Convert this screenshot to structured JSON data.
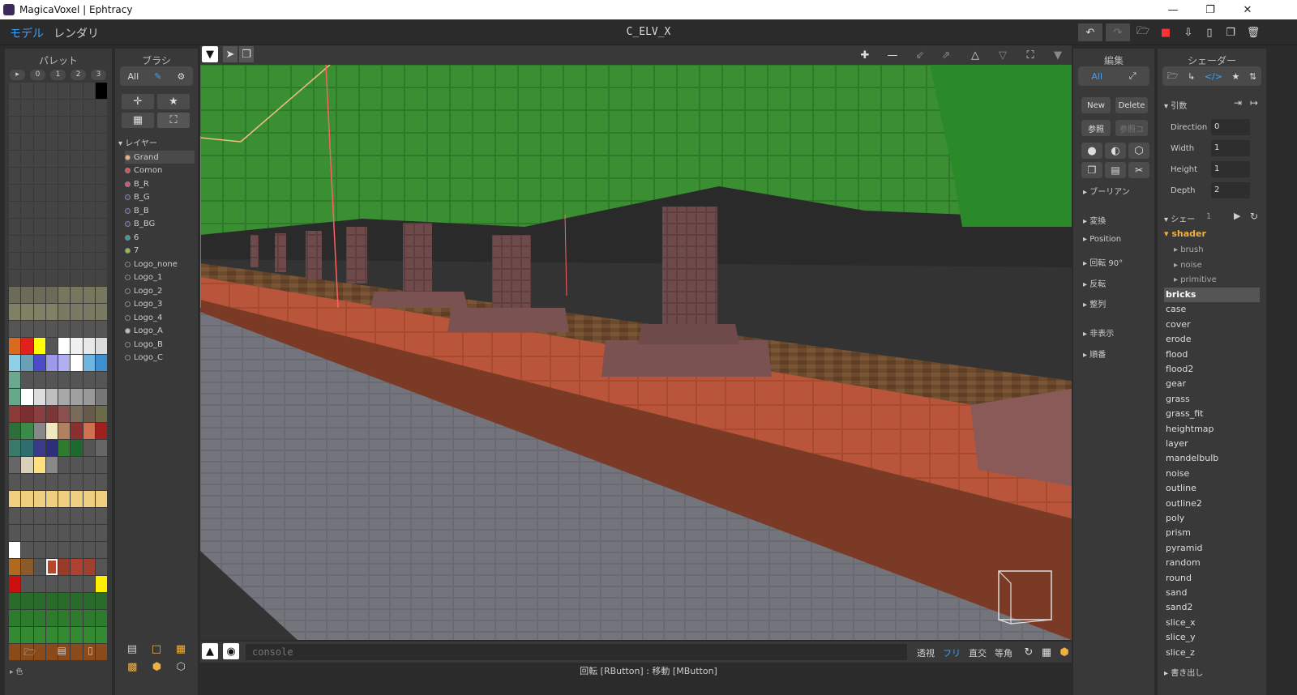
{
  "window": {
    "title": "MagicaVoxel | Ephtracy"
  },
  "menu": {
    "tab_model": "モデル",
    "tab_render": "レンダリ",
    "document": "C_ELV_X"
  },
  "palette": {
    "title": "パレット",
    "tabs": [
      "▸",
      "0",
      "1",
      "2",
      "3"
    ],
    "footer_label": "▸ 色",
    "rows": [
      [
        "#444",
        "#444",
        "#444",
        "#444",
        "#444",
        "#444",
        "#444",
        "#000"
      ],
      [
        "#444",
        "#444",
        "#444",
        "#444",
        "#444",
        "#444",
        "#444",
        "#444"
      ],
      [
        "#444",
        "#444",
        "#444",
        "#444",
        "#444",
        "#444",
        "#444",
        "#444"
      ],
      [
        "#444",
        "#444",
        "#444",
        "#444",
        "#444",
        "#444",
        "#444",
        "#444"
      ],
      [
        "#444",
        "#444",
        "#444",
        "#444",
        "#444",
        "#444",
        "#444",
        "#444"
      ],
      [
        "#444",
        "#444",
        "#444",
        "#444",
        "#444",
        "#444",
        "#444",
        "#444"
      ],
      [
        "#444",
        "#444",
        "#444",
        "#444",
        "#444",
        "#444",
        "#444",
        "#444"
      ],
      [
        "#444",
        "#444",
        "#444",
        "#444",
        "#444",
        "#444",
        "#444",
        "#444"
      ],
      [
        "#444",
        "#444",
        "#444",
        "#444",
        "#444",
        "#444",
        "#444",
        "#444"
      ],
      [
        "#444",
        "#444",
        "#444",
        "#444",
        "#444",
        "#444",
        "#444",
        "#444"
      ],
      [
        "#444",
        "#444",
        "#444",
        "#444",
        "#444",
        "#444",
        "#444",
        "#444"
      ],
      [
        "#444",
        "#444",
        "#444",
        "#444",
        "#444",
        "#444",
        "#444",
        "#444"
      ],
      [
        "#6b6b5a",
        "#6b6b5a",
        "#6b6b5a",
        "#6b6b5a",
        "#77775e",
        "#77775e",
        "#77775e",
        "#77775e"
      ],
      [
        "#808066",
        "#808066",
        "#808066",
        "#808066",
        "#7a7a62",
        "#7a7a62",
        "#7a7a62",
        "#7a7a62"
      ],
      [
        "#555",
        "#555",
        "#555",
        "#555",
        "#555",
        "#555",
        "#555",
        "#555"
      ],
      [
        "#d96a1f",
        "#e0201a",
        "#ffff00",
        "#555",
        "#ffffff",
        "#f0f0f0",
        "#e8e8e8",
        "#dcdcdc"
      ],
      [
        "#8fcfe8",
        "#6b9fb5",
        "#4b4bc8",
        "#9b9be8",
        "#b0b0f0",
        "#ffffff",
        "#6fb5e0",
        "#3d8fcf"
      ],
      [
        "#6aa890",
        "#555",
        "#555",
        "#555",
        "#555",
        "#555",
        "#555",
        "#555"
      ],
      [
        "#66a88a",
        "#ffffff",
        "#dddddd",
        "#bfbfbf",
        "#a8a8a8",
        "#a0a0a0",
        "#999",
        "#777"
      ],
      [
        "#8b3a3a",
        "#7a3030",
        "#8b4040",
        "#7a3838",
        "#8b5050",
        "#7a6a58",
        "#665a4a",
        "#6b6b4a"
      ],
      [
        "#2e6e3a",
        "#3a8a4a",
        "#888",
        "#f0e8c0",
        "#b08060",
        "#8b3030",
        "#d07050",
        "#a02020"
      ],
      [
        "#3a7a6a",
        "#2e6e6e",
        "#3a3a8a",
        "#2e2e7a",
        "#2e7a2e",
        "#1e6a2e",
        "#555",
        "#666"
      ],
      [
        "#666",
        "#d8d0b8",
        "#ffe080",
        "#888",
        "#555",
        "#555",
        "#555",
        "#555"
      ],
      [
        "#555",
        "#555",
        "#555",
        "#555",
        "#555",
        "#555",
        "#555",
        "#555"
      ],
      [
        "#f0d080",
        "#f0d080",
        "#f0d080",
        "#f0d080",
        "#f0d080",
        "#f0d080",
        "#f0d080",
        "#f0d080"
      ],
      [
        "#555",
        "#555",
        "#555",
        "#555",
        "#555",
        "#555",
        "#555",
        "#555"
      ],
      [
        "#555",
        "#555",
        "#555",
        "#555",
        "#555",
        "#555",
        "#555",
        "#555"
      ],
      [
        "#ffffff",
        "#555",
        "#555",
        "#555",
        "#555",
        "#555",
        "#555",
        "#555"
      ],
      [
        "#b06a20",
        "#8b5a2a",
        "#555",
        "#b8452e",
        "#9a3a28",
        "#b04030",
        "#a04030",
        "#555"
      ],
      [
        "#cc1010",
        "#555",
        "#555",
        "#555",
        "#555",
        "#555",
        "#555",
        "#ffee00"
      ],
      [
        "#2a6a2a",
        "#2a6a2a",
        "#2a6a2a",
        "#2a6a2a",
        "#2a6a2a",
        "#2a6a2a",
        "#2a6a2a",
        "#2a6a2a"
      ],
      [
        "#2e7a2e",
        "#2e7a2e",
        "#2e7a2e",
        "#2e7a2e",
        "#2e7a2e",
        "#2e7a2e",
        "#2e7a2e",
        "#2e7a2e"
      ],
      [
        "#338a33",
        "#338a33",
        "#338a33",
        "#338a33",
        "#338a33",
        "#338a33",
        "#338a33",
        "#338a33"
      ],
      [
        "#8b4a1a",
        "#8b4a1a",
        "#8b4a1a",
        "#8b4a1a",
        "#8b4a1a",
        "#8b4a1a",
        "#8b4a1a",
        "#8b4a1a"
      ]
    ]
  },
  "brush": {
    "title": "ブラシ",
    "filter_label": "All",
    "layers_title": "▾ レイヤー",
    "layers": [
      {
        "name": "Grand",
        "color": "#f0b080",
        "selected": true
      },
      {
        "name": "Comon",
        "color": "#e05050"
      },
      {
        "name": "B_R",
        "color": "#e05070"
      },
      {
        "name": "B_G",
        "color": "#404060"
      },
      {
        "name": "B_B",
        "color": "#404060"
      },
      {
        "name": "B_BG",
        "color": "#404060"
      },
      {
        "name": "6",
        "color": "#30a0a0"
      },
      {
        "name": "7",
        "color": "#90c040"
      },
      {
        "name": "Logo_none",
        "color": "#393939"
      },
      {
        "name": "Logo_1",
        "color": "#393939"
      },
      {
        "name": "Logo_2",
        "color": "#393939"
      },
      {
        "name": "Logo_3",
        "color": "#393939"
      },
      {
        "name": "Logo_4",
        "color": "#393939"
      },
      {
        "name": "Logo_A",
        "color": "#bbbbbb"
      },
      {
        "name": "Logo_B",
        "color": "#393939"
      },
      {
        "name": "Logo_C",
        "color": "#393939"
      }
    ]
  },
  "viewport": {
    "console_placeholder": "console",
    "view_modes": [
      "透視",
      "フリ",
      "直交",
      "等角"
    ],
    "status": "回転 [RButton] : 移動 [MButton]"
  },
  "edit": {
    "title": "編集",
    "filter_label": "All",
    "new_label": "New",
    "delete_label": "Delete",
    "ref_label": "参照",
    "ref2_label": "参照コ",
    "sections": [
      "▸ ブーリアン",
      "▸ 変換",
      "▸ Position",
      "▸ 回転 90°",
      "▸ 反転",
      "▸ 整列",
      "▸ 非表示",
      "▸ 順番"
    ]
  },
  "shader": {
    "title": "シェーダー",
    "args_label": "▾ 引数",
    "params": [
      {
        "label": "Direction",
        "value": "0"
      },
      {
        "label": "Width",
        "value": "1"
      },
      {
        "label": "Height",
        "value": "1"
      },
      {
        "label": "Depth",
        "value": "2"
      }
    ],
    "shader_section": "▾ シェー",
    "shader_count": "1",
    "tree_root": "▾ shader",
    "tree_children": [
      "▸ brush",
      "▸ noise",
      "▸ primitive"
    ],
    "items": [
      "bricks",
      "case",
      "cover",
      "erode",
      "flood",
      "flood2",
      "gear",
      "grass",
      "grass_fit",
      "heightmap",
      "layer",
      "mandelbulb",
      "noise",
      "outline",
      "outline2",
      "poly",
      "prism",
      "pyramid",
      "random",
      "round",
      "sand",
      "sand2",
      "slice_x",
      "slice_y",
      "slice_z"
    ],
    "selected": "bricks",
    "export_label": "▸ 書き出し"
  },
  "colors": {
    "accent": "#3aa0ff",
    "orange": "#f0b040"
  }
}
